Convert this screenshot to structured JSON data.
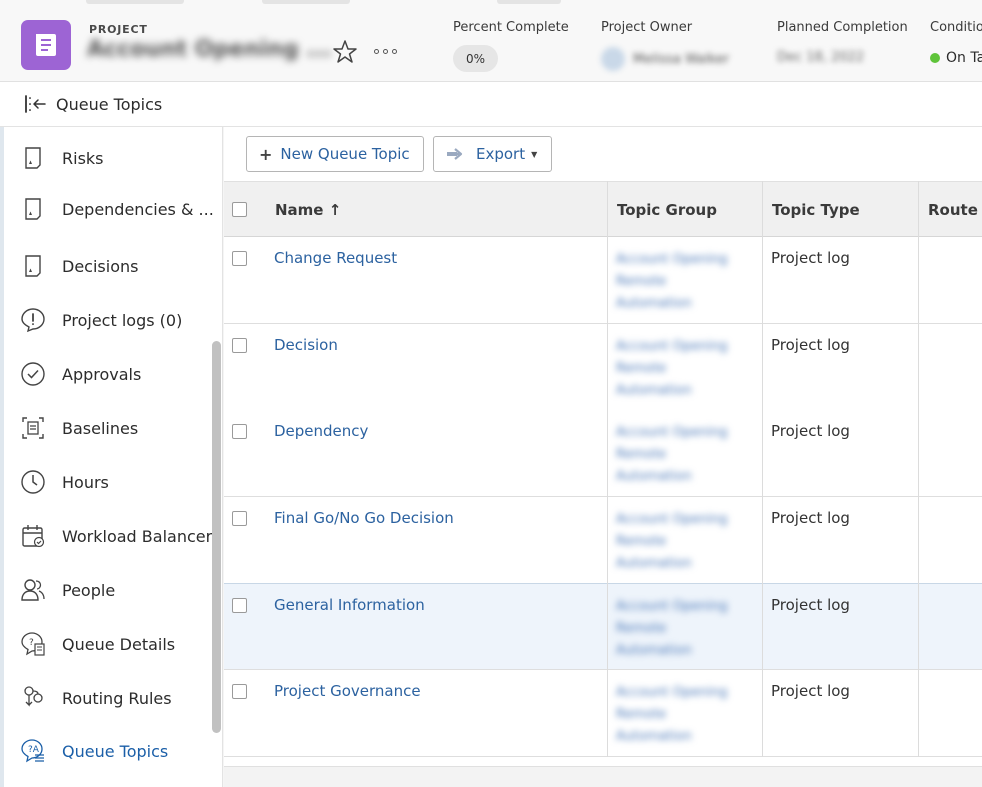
{
  "header": {
    "project_label": "PROJECT",
    "project_name": "Account Opening ...",
    "percent_complete_label": "Percent Complete",
    "percent_complete_value": "0%",
    "project_owner_label": "Project Owner",
    "project_owner_value": "Melissa Walker",
    "planned_completion_label": "Planned Completion",
    "planned_completion_value": "Dec 18, 2022",
    "condition_label": "Condition",
    "condition_value": "On Ta",
    "condition_color": "#5fc43a"
  },
  "titlebar": {
    "title": "Queue Topics"
  },
  "sidebar": {
    "items": [
      {
        "label": "Risks",
        "icon": "risk-icon"
      },
      {
        "label": "Dependencies & ...",
        "icon": "dependencies-icon"
      },
      {
        "label": "Decisions",
        "icon": "decisions-icon"
      },
      {
        "label": "Project logs (0)",
        "icon": "project-log-icon"
      },
      {
        "label": "Approvals",
        "icon": "approvals-icon"
      },
      {
        "label": "Baselines",
        "icon": "baselines-icon"
      },
      {
        "label": "Hours",
        "icon": "hours-icon"
      },
      {
        "label": "Workload Balancer",
        "icon": "workload-balancer-icon"
      },
      {
        "label": "People",
        "icon": "people-icon"
      },
      {
        "label": "Queue Details",
        "icon": "queue-details-icon"
      },
      {
        "label": "Routing Rules",
        "icon": "routing-rules-icon"
      },
      {
        "label": "Queue Topics",
        "icon": "queue-topics-icon",
        "active": true
      }
    ]
  },
  "toolbar": {
    "new_label": "New Queue Topic",
    "export_label": "Export"
  },
  "table": {
    "columns": [
      "Name ↑",
      "Topic Group",
      "Topic Type",
      "Route to"
    ],
    "rows": [
      {
        "name": "Change Request",
        "group": "Account Opening Remote Automation",
        "type": "Project log"
      },
      {
        "name": "Decision",
        "group": "Account Opening Remote Automation",
        "type": "Project log"
      },
      {
        "name": "Dependency",
        "group": "Account Opening Remote Automation",
        "type": "Project log"
      },
      {
        "name": "Final Go/No Go Decision",
        "group": "Account Opening Remote Automation",
        "type": "Project log"
      },
      {
        "name": "General Information",
        "group": "Account Opening Remote Automation",
        "type": "Project log"
      },
      {
        "name": "Project Governance",
        "group": "Account Opening Remote Automation",
        "type": "Project log"
      }
    ]
  },
  "colors": {
    "accent": "#2c62a0",
    "project_icon": "#9d64d4",
    "active_nav": "#1b5fa8"
  }
}
